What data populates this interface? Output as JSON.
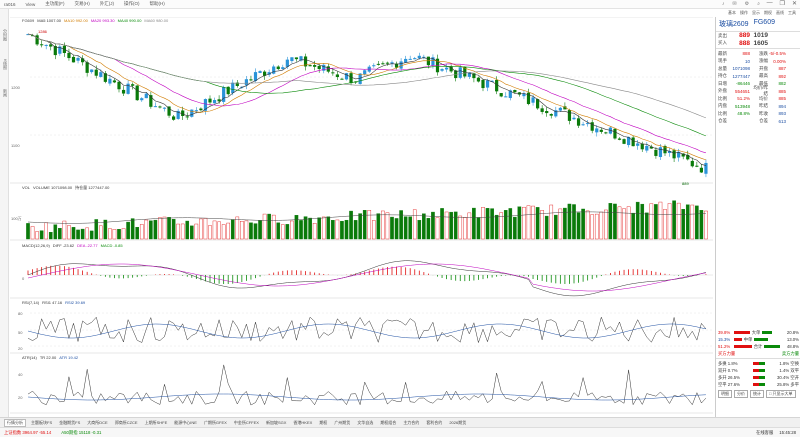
{
  "titlebar": {
    "items": [
      "ra016",
      "View",
      "主功能(F)",
      "交易(H)",
      "外汇(J)",
      "操作(O)",
      "帮助(H)"
    ],
    "icons": [
      "bell-icon",
      "mail-icon",
      "settings-icon",
      "search-icon"
    ],
    "controls": [
      "—",
      "❐",
      "✕"
    ]
  },
  "toolbar2": [
    "基本",
    "操作",
    "显示",
    "期权",
    "画线",
    "工具"
  ],
  "leftbar": [
    "分时图",
    "K线图",
    "新闻"
  ],
  "main_panel": {
    "indicators": [
      {
        "text": "FG609",
        "color": "#444"
      },
      {
        "text": "MA5 1007.00",
        "color": "#333"
      },
      {
        "text": "MA10 992.00",
        "color": "#d17c00"
      },
      {
        "text": "MA20 993.30",
        "color": "#c000c0"
      },
      {
        "text": "MA40 990.00",
        "color": "#0a8a0a"
      },
      {
        "text": "MA60 980.00",
        "color": "#888"
      }
    ],
    "high_label": "1286",
    "low_label": "889",
    "y_ticks": [
      "1300",
      "1200",
      "1100",
      "1000"
    ]
  },
  "volume_panel": {
    "indicators": [
      {
        "text": "VOL",
        "color": "#333"
      },
      {
        "text": "VOLUME 1071098.00",
        "color": "#333"
      },
      {
        "text": "持仓量 1277447.00",
        "color": "#333"
      }
    ],
    "y_ticks": [
      "100万"
    ]
  },
  "macd_panel": {
    "indicators": [
      {
        "text": "MACD(12,26,9)",
        "color": "#333"
      },
      {
        "text": "DIFF -23.62",
        "color": "#333"
      },
      {
        "text": "DEA -22.77",
        "color": "#c000c0"
      },
      {
        "text": "MACD -0.85",
        "color": "#0a8a0a"
      }
    ],
    "y_ticks": [
      "0"
    ]
  },
  "rsi_panel": {
    "indicators": [
      {
        "text": "RSI(7,14)",
        "color": "#333"
      },
      {
        "text": "RSI1 47.16",
        "color": "#333"
      },
      {
        "text": "RSI2 39.69",
        "color": "#1d4fa3"
      }
    ],
    "y_ticks": [
      "80",
      "50",
      "20"
    ]
  },
  "atr_panel": {
    "indicators": [
      {
        "text": "ATR(14)",
        "color": "#333"
      },
      {
        "text": "TR 22.00",
        "color": "#333"
      },
      {
        "text": "ATR 19.42",
        "color": "#1d4fa3"
      }
    ],
    "y_ticks": [
      "40",
      "20"
    ]
  },
  "x_axis": [
    "2025/12/01",
    "2026/02/02",
    "2026/03/02",
    "2026/04/01",
    "2026/05/05"
  ],
  "quote": {
    "name": "玻璃2609",
    "code": "FG609",
    "rows": [
      {
        "c1": "卖出",
        "c2": "889",
        "c2c": "red",
        "c3": "1019",
        "c4": "",
        "c5": "",
        "big": true
      },
      {
        "c1": "买入",
        "c2": "888",
        "c2c": "red",
        "c3": "1605",
        "c4": "",
        "c5": "",
        "big": true
      },
      {
        "c1": "最新",
        "c2": "888",
        "c2c": "red",
        "c3": "涨跌",
        "c4": "",
        "c5": "-5/-0.5%",
        "c5c": "red"
      },
      {
        "c1": "现手",
        "c2": "10",
        "c2c": "blu",
        "c3": "涨幅",
        "c4": "",
        "c5": "0.00%",
        "c5c": "red"
      },
      {
        "c1": "总量",
        "c2": "1071098",
        "c2c": "blu",
        "c3": "开盘",
        "c4": "",
        "c5": "887",
        "c5c": "red"
      },
      {
        "c1": "持仓",
        "c2": "1277447",
        "c2c": "blu",
        "c3": "最高",
        "c4": "",
        "c5": "892",
        "c5c": "red"
      },
      {
        "c1": "日增",
        "c2": "-86446",
        "c2c": "grn",
        "c3": "最低",
        "c4": "",
        "c5": "882",
        "c5c": "grn"
      },
      {
        "c1": "外盘",
        "c2": "554651",
        "c2c": "red",
        "c3": "均价/昨结",
        "c4": "",
        "c5": "885",
        "c5c": "red"
      },
      {
        "c1": "比例",
        "c2": "51.2%",
        "c2c": "red",
        "c3": "均价",
        "c4": "",
        "c5": "885",
        "c5c": "red"
      },
      {
        "c1": "内盘",
        "c2": "513948",
        "c2c": "grn",
        "c3": "昨结",
        "c4": "",
        "c5": "894",
        "c5c": "blu"
      },
      {
        "c1": "比例",
        "c2": "48.8%",
        "c2c": "grn",
        "c3": "昨收",
        "c4": "",
        "c5": "893",
        "c5c": "blu"
      },
      {
        "c1": "仓差",
        "c2": "",
        "c2c": "blu",
        "c3": "仓差",
        "c4": "",
        "c5": "613",
        "c5c": "blu"
      }
    ]
  },
  "flow": {
    "rows1": [
      {
        "l": "39.8%",
        "lc": "#e01010",
        "m1": "大单",
        "rw": 16,
        "gw": 10,
        "r": "20.8%"
      },
      {
        "l": "15.3%",
        "lc": "#1d4fa3",
        "m1": "中单",
        "rw": 8,
        "gw": 14,
        "r": "13.0%"
      },
      {
        "l": "51.2%",
        "lc": "#e01010",
        "m1": "合计",
        "rw": 18,
        "gw": 16,
        "r": "48.8%"
      }
    ],
    "summary": [
      "买方力量",
      "卖方力量"
    ],
    "rows2": [
      {
        "l": "多换 1.8%",
        "r": "1.8% 空换"
      },
      {
        "l": "双开 0.7%",
        "r": "1.4% 双平"
      },
      {
        "l": "多开 26.5%",
        "r": "30.4% 空开"
      },
      {
        "l": "空平 27.6%",
        "r": "25.8% 多平"
      }
    ],
    "buttons": [
      "明细",
      "分价",
      "统计"
    ],
    "checkbox": "□ 只显示大单"
  },
  "bottom_tabs": [
    "行情分析",
    "主题板块FS",
    "金融期货FS",
    "大商所DCE",
    "郑商所CZCE",
    "上期所SHFE",
    "能源中心INE",
    "广期所GFEX",
    "中金所CFFEX",
    "新加坡SGX",
    "香港HKEX",
    "期权",
    "广州期货",
    "文华自选",
    "期权组合",
    "主力合约",
    "套利合约",
    "2026期货"
  ],
  "statusbar": {
    "left": [
      {
        "text": "上证指数 3964.97 -55.14",
        "color": "#e01010"
      },
      {
        "text": "A50期指 15118 -0.31",
        "color": "#0a8a0a"
      }
    ],
    "right": [
      "在线客服",
      "15:45:28"
    ]
  }
}
